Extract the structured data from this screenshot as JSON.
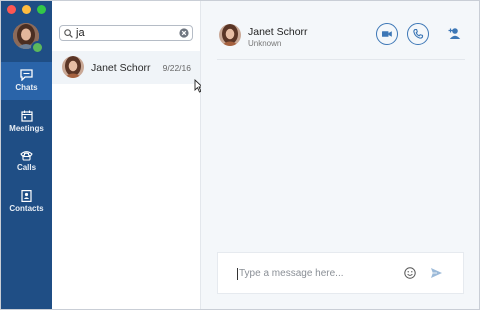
{
  "window": {
    "traffic_lights": [
      "close",
      "minimize",
      "zoom"
    ]
  },
  "user": {
    "presence_color": "#5cb85c"
  },
  "nav": {
    "items": [
      {
        "label": "Chats",
        "icon": "chat-bubble-icon",
        "active": true
      },
      {
        "label": "Meetings",
        "icon": "calendar-icon",
        "active": false
      },
      {
        "label": "Calls",
        "icon": "phone-icon",
        "active": false
      },
      {
        "label": "Contacts",
        "icon": "contacts-book-icon",
        "active": false
      }
    ]
  },
  "search": {
    "value": "ja",
    "placeholder": ""
  },
  "results": [
    {
      "name": "Janet Schorr",
      "date": "9/22/16"
    }
  ],
  "conversation": {
    "name": "Janet Schorr",
    "status": "Unknown",
    "actions": [
      "video-call-icon",
      "audio-call-icon",
      "add-participant-icon"
    ]
  },
  "composer": {
    "placeholder": "Type a message here..."
  },
  "colors": {
    "rail": "#1f4e85",
    "rail_active": "#2a64a9",
    "accent": "#3d77b6",
    "chat_bg": "#f4f7fa"
  }
}
